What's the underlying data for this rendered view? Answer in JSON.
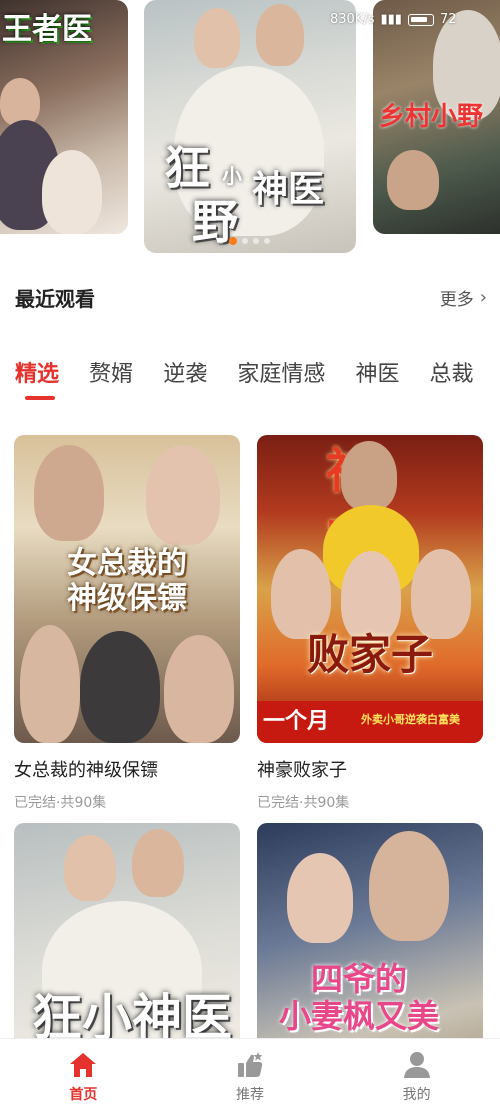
{
  "status_bar": {
    "net_speed": "830K/s",
    "battery": "72"
  },
  "carousel": {
    "left_title": "王者医",
    "mid_title_chars": [
      "狂",
      "小",
      "神医",
      "野"
    ],
    "right_title": "乡村小野",
    "active_index": 1
  },
  "recent": {
    "title": "最近观看",
    "more_label": "更多"
  },
  "tabs": [
    {
      "label": "精选",
      "active": true
    },
    {
      "label": "赘婿",
      "active": false
    },
    {
      "label": "逆袭",
      "active": false
    },
    {
      "label": "家庭情感",
      "active": false
    },
    {
      "label": "神医",
      "active": false
    },
    {
      "label": "总裁",
      "active": false
    }
  ],
  "grid": [
    {
      "title": "女总裁的神级保镖",
      "meta": "已完结·共90集",
      "cover_text": "女总裁的\n神级保镖"
    },
    {
      "title": "神豪败家子",
      "meta": "已完结·共90集",
      "cover_top": "神 家",
      "cover_text": "败家子",
      "banner": "一个月",
      "banner_sub": "外卖小哥逆袭白富美"
    },
    {
      "title": "",
      "meta": "",
      "cover_text": "狂小神医"
    },
    {
      "title": "",
      "meta": "",
      "cover_text": "四爷的\n小妻枫又美"
    }
  ],
  "nav": [
    {
      "label": "首页",
      "icon": "home-icon",
      "active": true
    },
    {
      "label": "推荐",
      "icon": "thumbs-up-icon",
      "active": false
    },
    {
      "label": "我的",
      "icon": "user-icon",
      "active": false
    }
  ],
  "colors": {
    "accent": "#e5322d",
    "muted": "#9a9a9a"
  }
}
